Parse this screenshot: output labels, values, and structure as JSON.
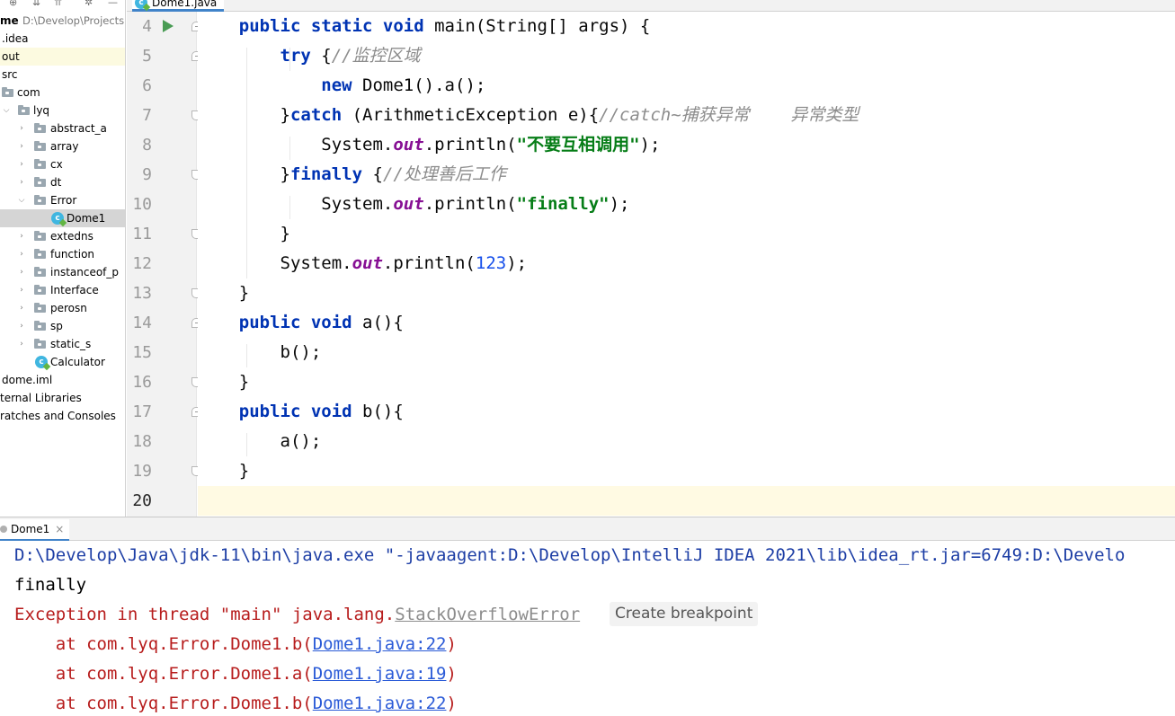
{
  "project": {
    "root_name": "me",
    "root_path": "D:\\Develop\\Projects",
    "items": [
      {
        "label": ".idea"
      },
      {
        "label": "out"
      },
      {
        "label": "src"
      },
      {
        "label": "com"
      },
      {
        "label": "lyq"
      },
      {
        "label": "abstract_a"
      },
      {
        "label": "array"
      },
      {
        "label": "cx"
      },
      {
        "label": "dt"
      },
      {
        "label": "Error"
      },
      {
        "label": "Dome1"
      },
      {
        "label": "extedns"
      },
      {
        "label": "function"
      },
      {
        "label": "instanceof_p"
      },
      {
        "label": "Interface"
      },
      {
        "label": "perosn"
      },
      {
        "label": "sp"
      },
      {
        "label": "static_s"
      },
      {
        "label": "Calculator"
      },
      {
        "label": "dome.iml"
      },
      {
        "label": "ternal Libraries"
      },
      {
        "label": "ratches and Consoles"
      }
    ]
  },
  "editor": {
    "tab_label": "Dome1.java",
    "line_numbers": [
      "4",
      "5",
      "6",
      "7",
      "8",
      "9",
      "10",
      "11",
      "12",
      "13",
      "14",
      "15",
      "16",
      "17",
      "18",
      "19",
      "20"
    ],
    "code": {
      "l4": {
        "kw1": "public static void",
        "rest": " main(String[] args) {"
      },
      "l5": {
        "kw": "try",
        "brace": " {",
        "comment": "//监控区域"
      },
      "l6": {
        "kw": "new",
        "rest": " Dome1().a();"
      },
      "l7": {
        "brace": "}",
        "kw": "catch",
        "rest": " (ArithmeticException e){",
        "comment": "//catch~捕获异常    异常类型"
      },
      "l8": {
        "pre": "System.",
        "field": "out",
        "mid": ".println(",
        "str": "\"不要互相调用\"",
        "post": ");"
      },
      "l9": {
        "brace": "}",
        "kw": "finally",
        "rest": " {",
        "comment": "//处理善后工作"
      },
      "l10": {
        "pre": "System.",
        "field": "out",
        "mid": ".println(",
        "str": "\"finally\"",
        "post": ");"
      },
      "l11": {
        "text": "}"
      },
      "l12": {
        "pre": "System.",
        "field": "out",
        "mid": ".println(",
        "num": "123",
        "post": ");"
      },
      "l13": {
        "text": "}"
      },
      "l14": {
        "kw": "public void",
        "rest": " a(){"
      },
      "l15": {
        "text": "b();"
      },
      "l16": {
        "text": "}"
      },
      "l17": {
        "kw": "public void",
        "rest": " b(){"
      },
      "l18": {
        "text": "a();"
      },
      "l19": {
        "text": "}"
      }
    }
  },
  "run": {
    "tab_label": "Dome1",
    "tab_close": "×",
    "console": {
      "cmd": "D:\\Develop\\Java\\jdk-11\\bin\\java.exe \"-javaagent:D:\\Develop\\IntelliJ IDEA 2021\\lib\\idea_rt.jar=6749:D:\\Develo",
      "finally": "finally",
      "exc_prefix": "Exception in thread \"main\" java.lang.",
      "exc_class": "StackOverflowError",
      "tooltip": "Create breakpoint",
      "frames": [
        {
          "prefix": "    at com.lyq.Error.Dome1.b(",
          "link": "Dome1.java:22",
          "suffix": ")"
        },
        {
          "prefix": "    at com.lyq.Error.Dome1.a(",
          "link": "Dome1.java:19",
          "suffix": ")"
        },
        {
          "prefix": "    at com.lyq.Error.Dome1.b(",
          "link": "Dome1.java:22",
          "suffix": ")"
        }
      ]
    }
  }
}
